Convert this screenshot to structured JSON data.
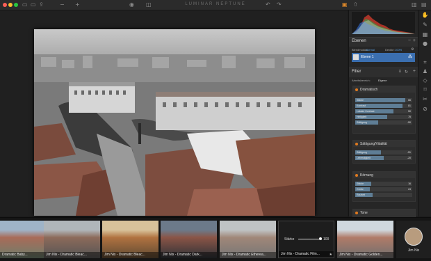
{
  "window": {
    "title": "LUMINAR NEPTUNE"
  },
  "layers": {
    "title": "Ebenen",
    "blend_label": "Blendmodus:",
    "blend_value": "Normal",
    "opacity_label": "Deckkr:",
    "opacity_value": "100%",
    "layer_name": "Ebene 1"
  },
  "filter": {
    "title": "Filter",
    "workspace_label": "Arbeitsbereich:",
    "workspace_value": "Eigene",
    "groups": [
      {
        "name": "Dramatisch",
        "rows": [
          {
            "label": "Stärke",
            "value": "66",
            "level": 0.88
          },
          {
            "label": "Kontrast",
            "value": "81",
            "level": 0.83
          },
          {
            "label": "Lokaler Kontrast",
            "value": "50",
            "level": 0.67
          },
          {
            "label": "Helligkeit",
            "value": "75",
            "level": 0.56
          },
          {
            "label": "Sättigung",
            "value": "-50",
            "level": 0.4
          }
        ]
      },
      {
        "name": "Sättigung/Vitalität",
        "rows": [
          {
            "label": "Sättigung",
            "value": "-51",
            "level": 0.45
          },
          {
            "label": "Lebendigkeit",
            "value": "-20",
            "level": 0.5
          }
        ]
      },
      {
        "name": "Körnung",
        "rows": [
          {
            "label": "Stärke",
            "value": "16",
            "level": 0.28
          },
          {
            "label": "Größe",
            "value": "24",
            "level": 0.25
          },
          {
            "label": "Rauheit",
            "value": "",
            "level": 0.3
          }
        ]
      },
      {
        "name": "Tone",
        "rows": []
      }
    ]
  },
  "presets": [
    {
      "name": "Dramatic Baby...",
      "active": false
    },
    {
      "name": "Jim Nix - Dramatic Bleac...",
      "active": false
    },
    {
      "name": "Jim Nix - Dramatic Bleac...",
      "active": false
    },
    {
      "name": "Jim Nix - Dramatic Dark...",
      "active": false
    },
    {
      "name": "Jim Nix - Dramatic Etherea...",
      "active": false
    },
    {
      "name": "Jim Nix - Dramatic Film...",
      "active": true,
      "slider_label": "Stärke",
      "slider_value": "100"
    },
    {
      "name": "Jim Nix - Dramatic Golden...",
      "active": false
    }
  ],
  "author": {
    "name": "Jim Nix"
  }
}
